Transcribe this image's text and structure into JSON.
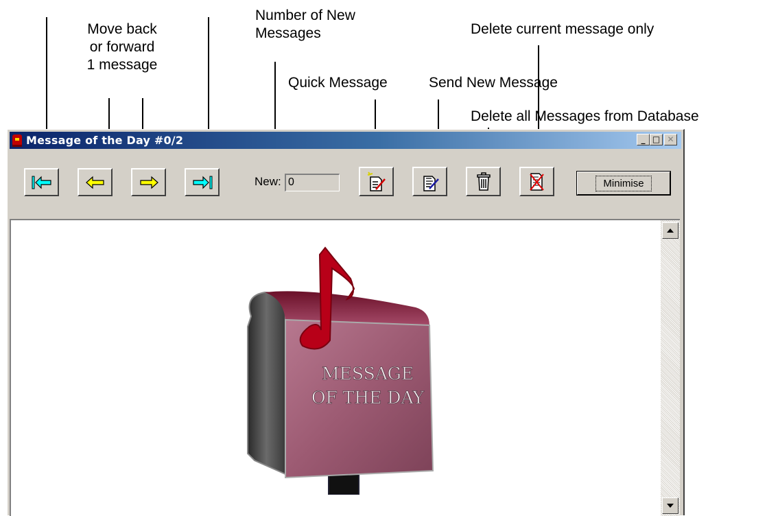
{
  "annotations": {
    "move_back_forward": [
      "Move back",
      "or forward",
      "1 message"
    ],
    "new_messages_count": [
      "Number of New",
      "Messages"
    ],
    "delete_current": "Delete current message only",
    "quick_message": "Quick Message",
    "send_new_message": "Send New Message",
    "delete_all": "Delete all Messages from Database"
  },
  "window": {
    "title": "Message of the Day  #0/2",
    "titlebar_controls": {
      "minimize": "_",
      "maximize": "□",
      "close": "✕"
    }
  },
  "toolbar": {
    "first_icon": "first-message-icon",
    "prev_icon": "previous-message-icon",
    "next_icon": "next-message-icon",
    "last_icon": "last-message-icon",
    "new_label": "New:",
    "new_value": "0",
    "quick_message_icon": "quick-message-icon",
    "send_new_message_icon": "send-new-message-icon",
    "delete_all_icon": "trash-icon",
    "delete_current_icon": "delete-message-icon",
    "minimise_label": "Minimise"
  },
  "content": {
    "image_text": [
      "MESSAGE",
      "OF THE DAY"
    ]
  },
  "colors": {
    "titlebar_start": "#0a246a",
    "titlebar_end": "#a6caf0",
    "arrow_cyan": "#00ffff",
    "arrow_yellow": "#ffff00",
    "mailbox_body": "#9c5a72",
    "music_note": "#b80018"
  }
}
